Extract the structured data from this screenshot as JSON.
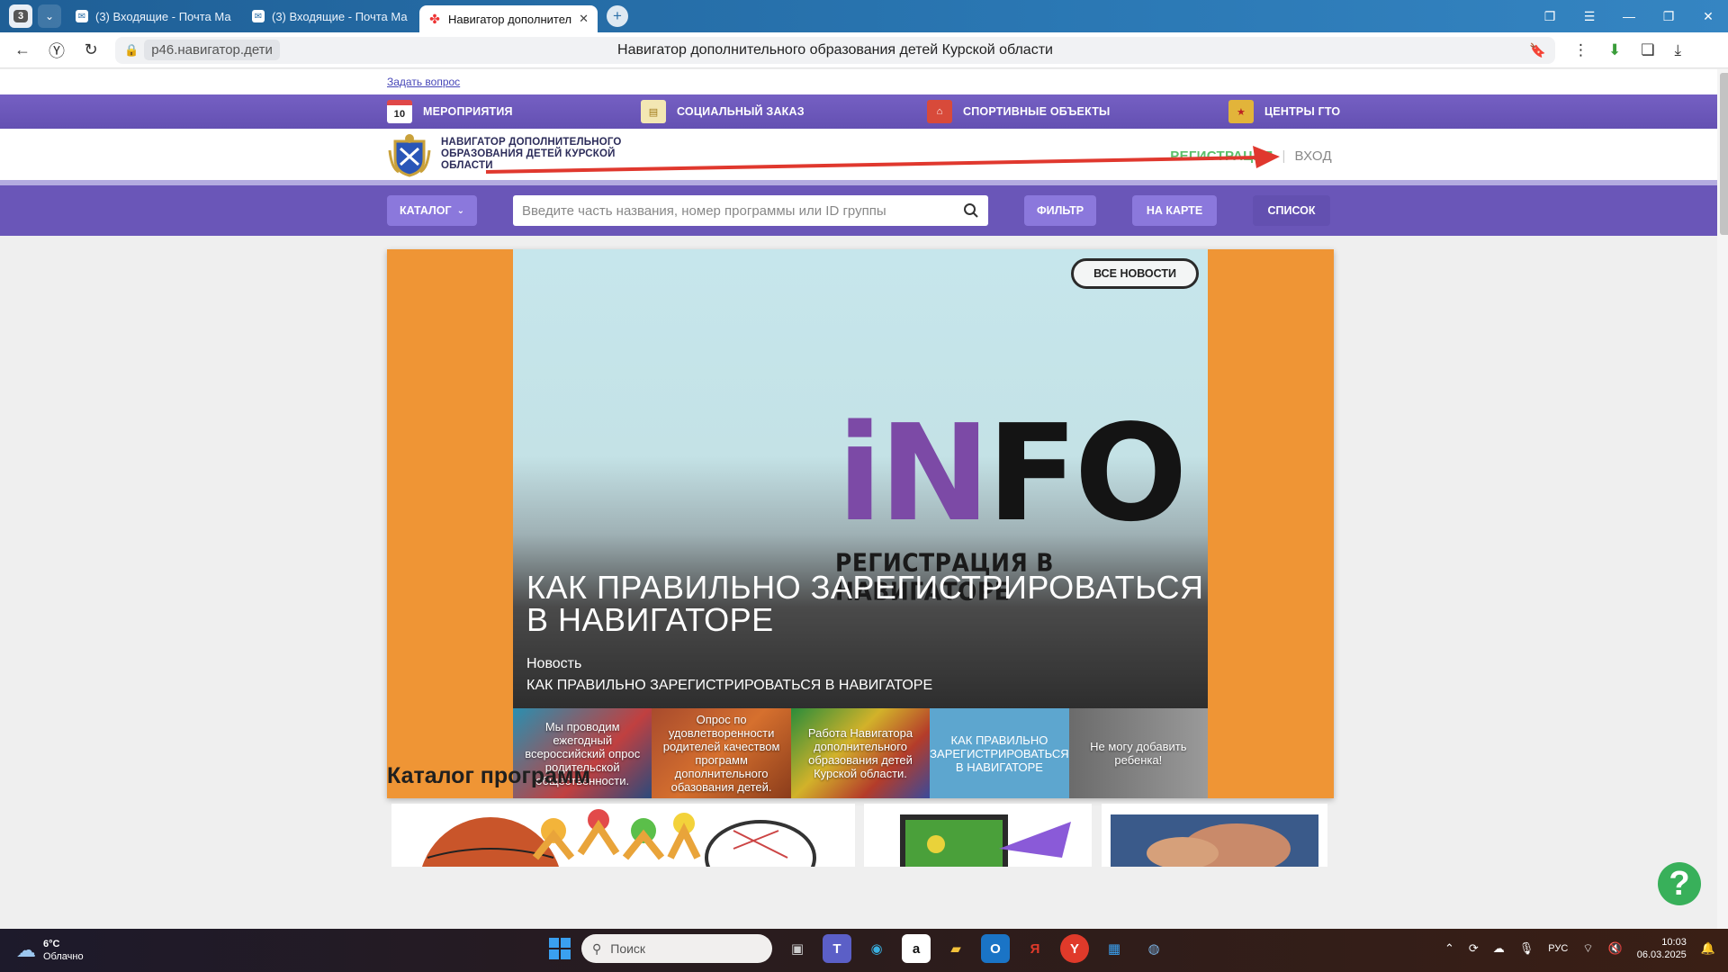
{
  "browser": {
    "tab_count": "3",
    "tabs": [
      {
        "label": "(3) Входящие - Почта Ма"
      },
      {
        "label": "(3) Входящие - Почта Ма"
      },
      {
        "label": "Навигатор дополнител"
      }
    ],
    "url_domain": "р46.навигатор.дети",
    "page_title": "Навигатор дополнительного образования детей Курской области"
  },
  "site": {
    "ask_link": "Задать вопрос",
    "topnav": [
      {
        "label": "МЕРОПРИЯТИЯ",
        "icon": "calendar-icon",
        "badge": "10"
      },
      {
        "label": "СОЦИАЛЬНЫЙ ЗАКАЗ",
        "icon": "certificate-icon"
      },
      {
        "label": "СПОРТИВНЫЕ ОБЪЕКТЫ",
        "icon": "stadium-icon"
      },
      {
        "label": "ЦЕНТРЫ ГТО",
        "icon": "gto-badge-icon"
      }
    ],
    "brand_name": "НАВИГАТОР ДОПОЛНИТЕЛЬНОГО ОБРАЗОВАНИЯ ДЕТЕЙ КУРСКОЙ ОБЛАСТИ",
    "auth": {
      "register": "РЕГИСТРАЦИЯ",
      "separator": "|",
      "login": "ВХОД"
    },
    "search": {
      "catalog_label": "КАТАЛОГ",
      "placeholder": "Введите часть названия, номер программы или ID группы",
      "filter_label": "ФИЛЬТР",
      "map_label": "НА КАРТЕ",
      "list_label": "СПИСОК"
    },
    "news": {
      "all_news": "ВСЕ НОВОСТИ",
      "banner_word_purple": "iN",
      "banner_word_black": "FO",
      "banner_sub": "РЕГИСТРАЦИЯ В НАВИГАТОРЕ",
      "headline": "КАК ПРАВИЛЬНО ЗАРЕГИСТРИРОВАТЬСЯ В НАВИГАТОРЕ",
      "kind": "Новость",
      "caption": "КАК ПРАВИЛЬНО ЗАРЕГИСТРИРОВАТЬСЯ В НАВИГАТОРЕ",
      "thumbs": [
        "Мы проводим ежегодный всероссийский опрос родительской общественности.",
        "Опрос по удовлетворенности родителей качеством программ дополнительного обазования детей.",
        "Работа Навигатора дополнительного образования детей Курской области.",
        "КАК ПРАВИЛЬНО ЗАРЕГИСТРИРОВАТЬСЯ В НАВИГАТОРЕ",
        "Не могу добавить ребенка!"
      ]
    },
    "catalog_title": "Каталог программ",
    "help": "?"
  },
  "taskbar": {
    "weather_temp": "6°C",
    "weather_desc": "Облачно",
    "search_label": "Поиск",
    "lang": "РУС",
    "time": "10:03",
    "date": "06.03.2025"
  }
}
